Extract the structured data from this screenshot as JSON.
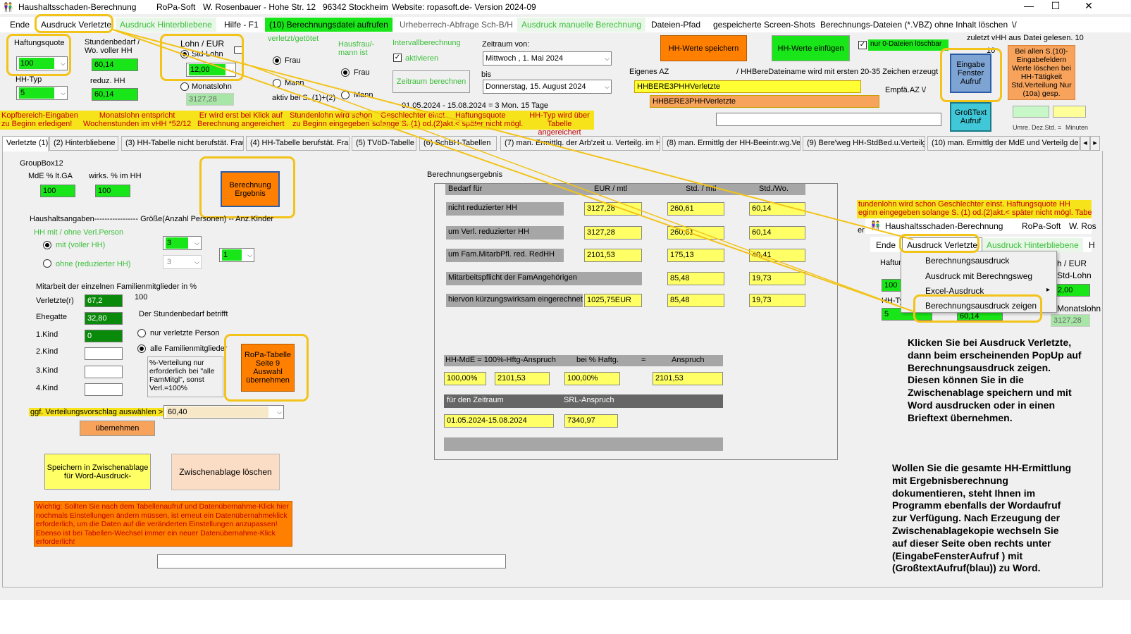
{
  "title": {
    "app": "Haushaltsschaden-Berechnung",
    "company": "RoPa-Soft",
    "address": "W. Rosenbauer - Hohe Str. 12",
    "city": "96342 Stockheim",
    "website": "Website: ropasoft.de",
    "version": "- Version 2024-09"
  },
  "window_controls": {
    "minimize": "—",
    "maximize": "☐",
    "close": "✕"
  },
  "menu": [
    "Ende",
    "Ausdruck Verletzte",
    "Ausdruck Hinterbliebene",
    "Hilfe - F1",
    "(10) Berechnungsdatei aufrufen",
    "Urheberrech-Abfrage Sch-B/H",
    "Ausdruck manuelle Berechnung",
    "Dateien-Pfad",
    "gespeicherte Screen-Shots",
    "Berechnungs-Dateien (*.VBZ) ohne Inhalt löschen",
    "\\/"
  ],
  "top": {
    "haftungsquote_label": "Haftungsquote",
    "haftungsquote": "100",
    "hhtyp_label": "HH-Typ",
    "hhtyp": "5",
    "stundenbedarf_label": "Stundenbedarf / Wo. voller HH",
    "stundenbedarf": "60,14",
    "reduz_label": "reduz. HH",
    "reduz": "60,14",
    "lohn_label": "Lohn / EUR",
    "stdlohn_label": "Std-Lohn",
    "stdlohn": "12,00",
    "monatslohn_label": "Monatslohn",
    "monatslohn": "3127,28",
    "verletzt_label": "verletzt/getötet",
    "frau": "Frau",
    "mann": "Mann",
    "aktiv_label": "aktiv  bei S. (1)+(2)",
    "hausfrau_label": "Hausfrau/-mann  ist",
    "intervall_label": "Intervallberechnung",
    "aktivieren": "aktivieren",
    "zeitraum_btn": "Zeitraum berechnen",
    "zeitraum_von_label": "Zeitraum von:",
    "von": "Mittwoch  ,    1.       Mai        2024",
    "bis_label": "bis",
    "bis": "Donnerstag, 15.    August    2024",
    "zeitraum_summary": "01.05.2024 - 15.08.2024    =  3 Mon.  15 Tage",
    "hh_speichern": "HH-Werte  speichern",
    "hh_einfuegen": "HH-Werte  einfügen",
    "nur0": "nur 0-Dateien löschbar",
    "zuletzt": "zuletzt vHH aus Datei gelesen. 10",
    "zuletzt_num": "10",
    "eingabe_btn": "Eingabe Fenster Aufruf",
    "grosstext_btn": "GroßText Aufruf",
    "info_orange": "Bei allen S.(10)-Eingabefeldern Werte löschen bei  HH-Tätigkeit Std.Verteilung Nur (10a) gesp.",
    "eigenes_az": "Eigenes AZ",
    "hhbere_label": "/   HHBereDateiname wird mit ersten 20-35 Zeichen  erzeugt",
    "az1": "HHBERE3PHHVerletzte",
    "az2": "HHBERE3PHHVerletzte",
    "empfa": "Empfä.AZ  \\/",
    "umre": "Umre.  Dez.Std.  =",
    "minuten": "Minuten"
  },
  "info_strip": [
    [
      "Kopfbereich-Eingaben",
      "zu Beginn erledigen!"
    ],
    [
      "Monatslohn entspricht",
      "Wochenstunden im vHH *52/12"
    ],
    [
      "Er wird erst bei Klick auf",
      "Berechnung angereichert"
    ],
    [
      "Stundenlohn wird schon",
      "zu Beginn eingegeben"
    ],
    [
      "Geschlechter einst.",
      "solange S. (1) od.(2)akt.< später nicht mögl."
    ],
    [
      "Haftungsquote",
      ""
    ],
    [
      "HH-Typ  wird über",
      "Tabelle angereichert"
    ]
  ],
  "tabs": [
    "Verletzte (1)",
    "(2)  Hinterbliebene",
    "(3) HH-Tabelle nicht berufstät. Frau",
    "(4) HH-Tabelle berufstät. Frau",
    "(5) TVöD-Tabelle",
    "(6) SchBH-Tabellen",
    "(7) man. Ermittlg. der Arb'zeit u. Verteilg. im HH",
    "(8) man. Ermittlg der HH-Beeintr.wg.Verl.",
    "(9) Bere'weg HH-StdBed.u.Verteilg.",
    "(10) man. Ermittlg der MdE und Verteilg der B"
  ],
  "left": {
    "groupbox": "GroupBox12",
    "mde_label": "MdE    % lt.GA",
    "wirks_label": "wirks. % im HH",
    "mde": "100",
    "wirks": "100",
    "berechnung_btn": "Berechnung Ergebnis",
    "haushalt_label": "Haushaltsangaben-----------------  Größe(Anzahl Personen)  --  Anz.Kinder",
    "hh_mit_label": "HH mit / ohne Verl.Person",
    "mit": "mit (voller HH)",
    "ohne": "ohne (reduzierter HH)",
    "groesse1": "3",
    "groesse2": "3",
    "kinder": "1",
    "mitarbeit_label": "Mitarbeit der einzelnen Familienmitglieder in %",
    "hundred": "100",
    "verletzte_label": "Verletzte(r)",
    "verletzte": "67,2",
    "ehegatte_label": "Ehegatte",
    "ehegatte": "32,80",
    "kind1_label": "1.Kind",
    "kind1": "0",
    "kind2_label": "2.Kind",
    "kind3_label": "3.Kind",
    "kind4_label": "4.Kind",
    "stundenbedarf_betrifft": "Der Stundenbedarf betrifft",
    "nur_verletzte": "nur verletzte Person",
    "alle_fam": "alle Familienmitglieder",
    "verteilung_note": "%-Verteilung nur erforderlich bei \"alle FamMitgl\", sonst Verl.=100%",
    "ropa_btn": "RoPa-Tabelle Seite 9 Auswahl übernehmen",
    "vorschlag_label": "ggf. Verteilungsvorschlag auswählen >",
    "vorschlag": "60,40",
    "uebernehmen": "übernehmen",
    "speichern_btn": "Speichern in Zwischenablage für Word-Ausdruck-",
    "loeschen_btn": "Zwischenablage löschen",
    "warning": "Wichtig: Sollten Sie nach dem Tabellenaufruf und Datenübernahme-Klick hier nochmals Einstellungen ändern müssen, ist erneut ein Datenübernahmeklick erforderlich, um die Daten auf die veränderten Einstellungen anzupassen! Ebenso ist bei Tabellen-Wechsel immer ein neuer Datenübernahme-Klick erforderlich!"
  },
  "result": {
    "title": "Berechnungsergebnis",
    "headers": [
      "Bedarf für",
      "EUR /  mtl",
      "Std. / mtl",
      "Std./Wo."
    ],
    "rows": [
      {
        "label": "nicht reduzierter HH",
        "eur": "3127,28",
        "std": "260,61",
        "wo": "60,14"
      },
      {
        "label": "um Verl. reduzierter HH",
        "eur": "3127,28",
        "std": "260,61",
        "wo": "60,14"
      },
      {
        "label": "um Fam.MitarbPfl. red. RedHH",
        "eur": "2101,53",
        "std": "175,13",
        "wo": "40,41"
      },
      {
        "label": "Mitarbeitspflicht der FamAngehörigen",
        "eur": "",
        "std": "85,48",
        "wo": "19,73"
      },
      {
        "label": "hiervon kürzungswirksam eingerechnet",
        "eur": "1025,75EUR",
        "std": "85,48",
        "wo": "19,73"
      }
    ],
    "mde_header": [
      "HH-MdE  =  100%-Hftg-Anspruch",
      "bei % Haftg.",
      "=",
      "Anspruch"
    ],
    "mde_values": [
      "100,00%",
      "2101,53",
      "100,00%",
      "2101,53"
    ],
    "zeitraum_header": [
      "für den Zeitraum",
      "SRL-Anspruch"
    ],
    "zeitraum_values": [
      "01.05.2024-15.08.2024",
      "7340,97"
    ]
  },
  "zoom": {
    "strip": "eginn eingegeben    solange S. (1) od.(2)akt.< später nicht mögl.    Tabe",
    "strip_top": "tundenlohn wird schon     Geschlechter einst.     Haftungsquote     HH",
    "title": "Haushaltsschaden-Berechnung",
    "company": "RoPa-Soft",
    "author": "W. Ros",
    "menu": [
      "Ende",
      "Ausdruck Verletzte",
      "Ausdruck Hinterbliebene",
      "H"
    ],
    "popup": [
      "Berechnungsausdruck",
      "Ausdruck mit Berechngsweg",
      "Excel-Ausdruck",
      "Berechnungsausdruck zeigen"
    ],
    "frag_haftu": "Haftun",
    "frag_hhty": "HH-Ty",
    "frag_100": "100",
    "frag_5": "5",
    "frag_lohn": "h / EUR",
    "frag_stdlohn": "Std-Lohn",
    "frag_200": "2,00",
    "frag_monat": "Monatslohn",
    "frag_3127": "3127,28",
    "frag_60": "60,14",
    "frag_er": "er"
  },
  "instructions": {
    "p1": "Klicken Sie bei Ausdruck Verletzte, dann beim erscheinenden PopUp auf Berechnungsausdruck zeigen. Diesen können Sie in die Zwischenablage speichern und mit Word ausdrucken oder in einen Brieftext übernehmen.",
    "p2": "Wollen Sie die gesamte HH-Ermittlung mit Ergebnisberechnung dokumentieren, steht Ihnen im Programm ebenfalls der Wordaufruf zur Verfügung. Nach Erzeugung der Zwischenablagekopie wechseln Sie auf dieser Seite oben rechts unter (EingabeFensterAufruf ) mit (GroßtextAufruf(blau)) zu Word."
  },
  "colors": {
    "highlight": "#f2c318",
    "green": "#19e619",
    "dark_green": "#0a8a0a",
    "yellow": "#ffff66",
    "orange": "#ff7f00",
    "light_orange": "#f7a35c",
    "peach": "#fbdcc4",
    "info_yellow": "#f7e31a",
    "info_text": "#c00000",
    "blue_btn": "#7ea4d4",
    "cyan_btn": "#40c8d8"
  }
}
